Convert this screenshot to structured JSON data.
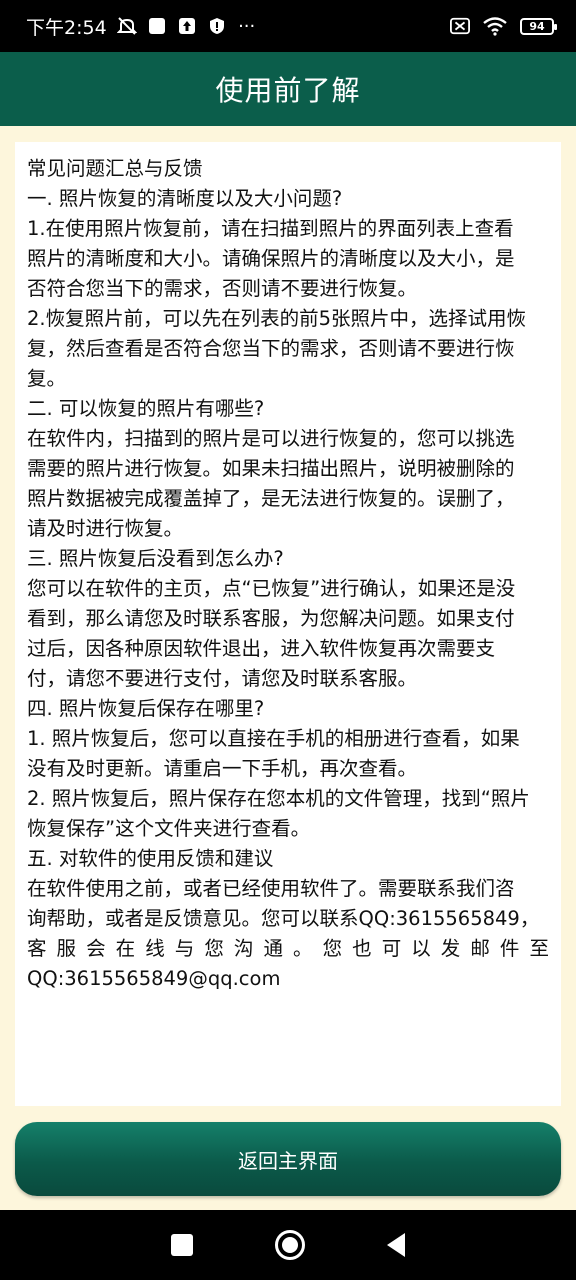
{
  "status_bar": {
    "time": "下午2:54",
    "battery": "94",
    "icons": [
      "mute-icon",
      "notification-square-icon",
      "upload-icon",
      "shield-icon",
      "more-dots-icon",
      "sim-off-icon",
      "wifi-icon",
      "battery-icon"
    ],
    "more": "···"
  },
  "header": {
    "title": "使用前了解"
  },
  "content": {
    "lines": [
      "常见问题汇总与反馈",
      "一. 照片恢复的清晰度以及大小问题?",
      "1.在使用照片恢复前，请在扫描到照片的界面列表上查看",
      "照片的清晰度和大小。请确保照片的清晰度以及大小，是",
      "否符合您当下的需求，否则请不要进行恢复。",
      "2.恢复照片前，可以先在列表的前5张照片中，选择试用恢",
      "复，然后查看是否符合您当下的需求，否则请不要进行恢",
      "复。",
      "二. 可以恢复的照片有哪些?",
      "在软件内，扫描到的照片是可以进行恢复的，您可以挑选",
      "需要的照片进行恢复。如果未扫描出照片，说明被删除的",
      "照片数据被完成覆盖掉了，是无法进行恢复的。误删了，",
      "请及时进行恢复。",
      "三. 照片恢复后没看到怎么办?",
      "您可以在软件的主页，点“已恢复”进行确认，如果还是没",
      "看到，那么请您及时联系客服，为您解决问题。如果支付",
      "过后，因各种原因软件退出，进入软件恢复再次需要支",
      "付，请您不要进行支付，请您及时联系客服。",
      "四. 照片恢复后保存在哪里?",
      "1. 照片恢复后，您可以直接在手机的相册进行查看，如果",
      "没有及时更新。请重启一下手机，再次查看。",
      "2. 照片恢复后，照片保存在您本机的文件管理，找到“照片",
      "恢复保存”这个文件夹进行查看。",
      "五. 对软件的使用反馈和建议",
      "在软件使用之前，或者已经使用软件了。需要联系我们咨",
      "询帮助，或者是反馈意见。您可以联系QQ:3615565849，",
      "客服会在线与您沟通。您也可以发邮件至",
      "QQ:3615565849@qq.com"
    ]
  },
  "footer": {
    "back_button_label": "返回主界面"
  },
  "colors": {
    "header_bg": "#0b5e4b",
    "page_bg": "#fdf6dc",
    "button_bg": "#0b5a4a"
  }
}
